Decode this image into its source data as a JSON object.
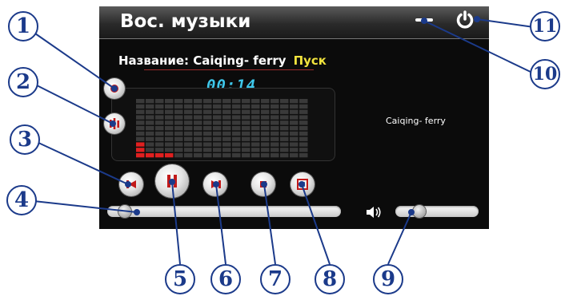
{
  "window": {
    "title": "Вос. музыки"
  },
  "controls": {
    "minimize_icon": "minimize-icon",
    "power_icon": "power-icon"
  },
  "track": {
    "label": "Название: Caiqing- ferry",
    "status": "Пуск",
    "time": "00:14",
    "title_right": "Caiqing- ferry"
  },
  "equalizer": {
    "columns": 18,
    "rows": 11,
    "levels": [
      3,
      1,
      1,
      1,
      0,
      0,
      0,
      0,
      0,
      0,
      0,
      0,
      0,
      0,
      0,
      0,
      0,
      0
    ],
    "active_color": "#e02020",
    "inactive_color": "#3a3a3a"
  },
  "progress": {
    "value": 0.05
  },
  "volume": {
    "value": 0.25
  },
  "callouts": [
    "1",
    "2",
    "3",
    "4",
    "5",
    "6",
    "7",
    "8",
    "9",
    "10",
    "11"
  ],
  "colors": {
    "accent_blue": "#3ec7ea",
    "status_yellow": "#f1e33d",
    "callout_blue": "#1b3a8a"
  }
}
